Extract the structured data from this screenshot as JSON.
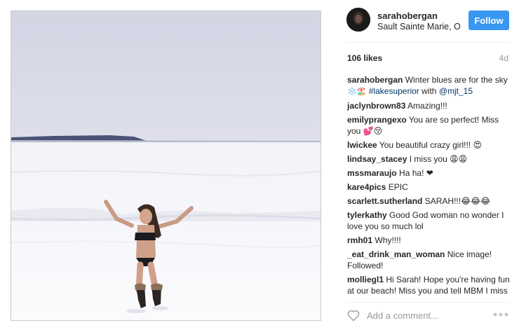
{
  "post": {
    "username": "sarahobergan",
    "location": "Sault Sainte Marie, O...",
    "follow_label": "Follow",
    "likes": "106 likes",
    "time_ago": "4d"
  },
  "caption": {
    "user": "sarahobergan",
    "text": "Winter blues are for the sky",
    "emojis": "❄️🏖️",
    "hashtag": "#lakesuperior",
    "with_text": "with",
    "mention": "@mjt_15"
  },
  "comments": [
    {
      "user": "jaclynbrown83",
      "text": "Amazing!!!"
    },
    {
      "user": "emilyprangexo",
      "text": "You are so perfect! Miss you 💕😚"
    },
    {
      "user": "lwickee",
      "text": "You beautiful crazy girl!!! 😍"
    },
    {
      "user": "lindsay_stacey",
      "text": "I miss you 😩😩"
    },
    {
      "user": "mssmaraujo",
      "text": "Ha ha! ❤"
    },
    {
      "user": "kare4pics",
      "text": "EPIC"
    },
    {
      "user": "scarlett.sutherland",
      "text": "SARAH!!!😂😂😂"
    },
    {
      "user": "tylerkathy",
      "text": "Good God woman no wonder I love you so much lol"
    },
    {
      "user": "rmh01",
      "text": "Why!!!!"
    },
    {
      "user": "_eat_drink_man_woman",
      "text": "Nice image! Followed!"
    },
    {
      "user": "molliegl1",
      "text": "Hi Sarah! Hope you're having fun at our beach! Miss you and tell MBM I miss him to!"
    }
  ],
  "add_comment": {
    "placeholder": "Add a comment..."
  },
  "icons": {
    "like": "heart-icon",
    "more": "more-options-icon"
  },
  "colors": {
    "follow_button": "#3897f0",
    "tag": "#003569",
    "muted": "#999999"
  }
}
